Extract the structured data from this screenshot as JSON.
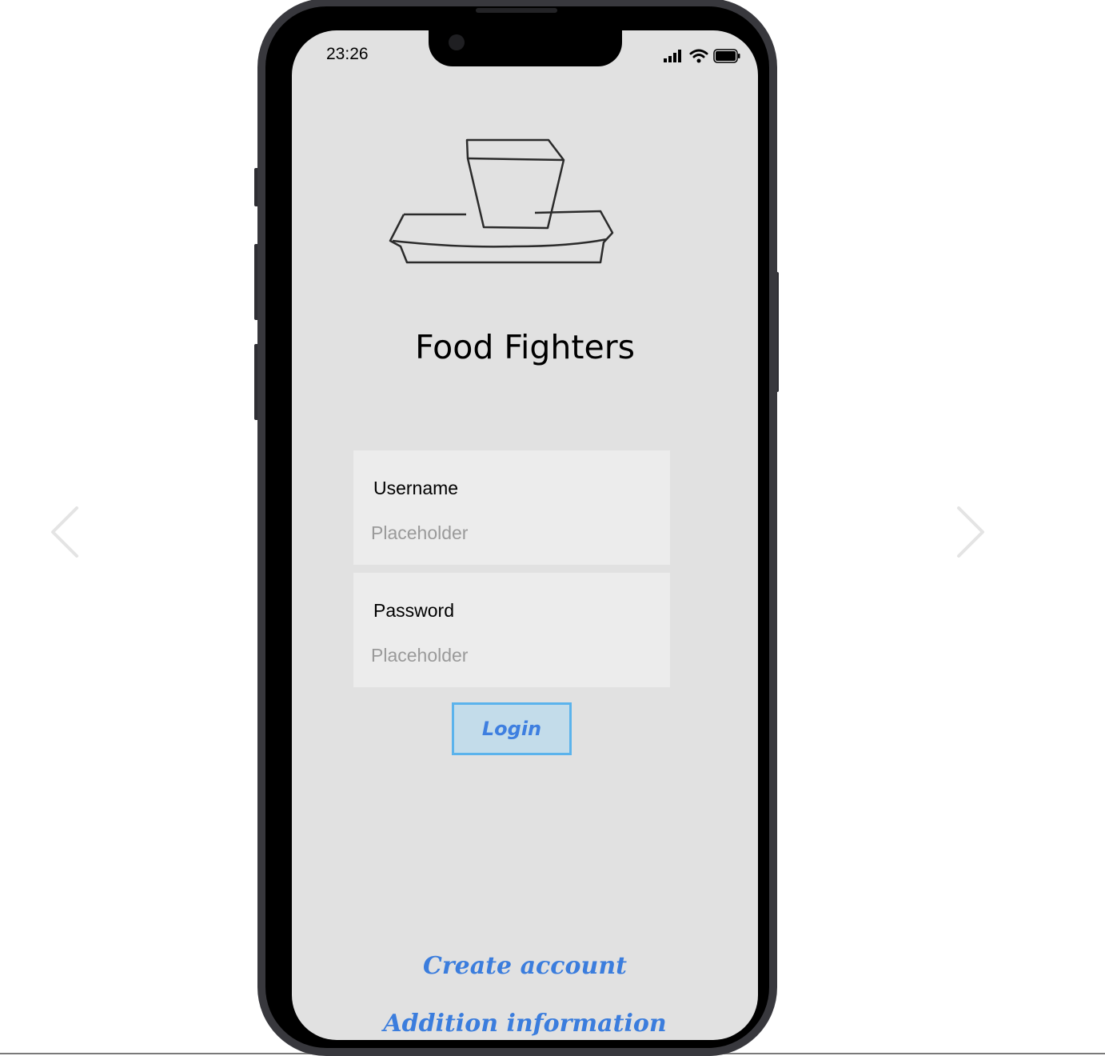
{
  "status_bar": {
    "time": "23:26"
  },
  "app": {
    "title": "Food Fighters"
  },
  "form": {
    "username": {
      "label": "Username",
      "placeholder": "Placeholder"
    },
    "password": {
      "label": "Password",
      "placeholder": "Placeholder"
    },
    "login_label": "Login"
  },
  "links": {
    "create_account": "Create account",
    "additional_info": "Addition information"
  },
  "colors": {
    "screen_bg": "#e1e1e1",
    "field_bg": "#ececec",
    "link": "#3b7ddd",
    "button_border": "#5bb3ec",
    "button_bg": "#c3dcea"
  },
  "icons": {
    "prev": "chevron-left-icon",
    "next": "chevron-right-icon",
    "logo": "food-tray-logo"
  }
}
